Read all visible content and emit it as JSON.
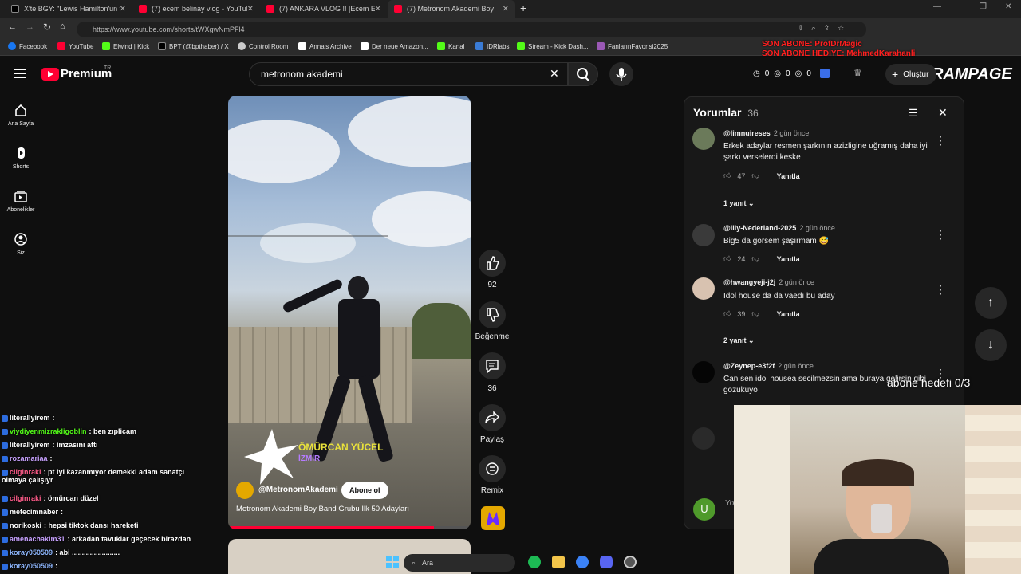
{
  "browser": {
    "tabs": [
      {
        "label": "X'te BGY: \"Lewis Hamilton'un fi",
        "color": "#000000"
      },
      {
        "label": "(7) ecem belinay vlog - YouTube",
        "color": "#ff0033"
      },
      {
        "label": "(7) ANKARA VLOG !! |Ecem Eser",
        "color": "#ff0033"
      },
      {
        "label": "(7) Metronom Akademi Boy",
        "color": "#ff0033"
      }
    ],
    "url": "https://www.youtube.com/shorts/tWXgwNmPFl4",
    "bookmarks": [
      "Facebook",
      "YouTube",
      "Elwind | Kick",
      "BPT (@bpthaber) / X",
      "Control Room",
      "Anna's Archive",
      "Der neue Amazon...",
      "Kanal",
      "IDRlabs",
      "Stream - Kick Dash...",
      "FanlarınFavorisi2025"
    ],
    "bookmark_colors": [
      "#1877f2",
      "#ff0033",
      "#53fc18",
      "#ffffff",
      "#cccccc",
      "#ffffff",
      "#ffffff",
      "#53fc18",
      "#3a7bd5",
      "#53fc18",
      "#9b59b6"
    ]
  },
  "overlay": {
    "top_line1": "SON ABONE: ProfDrMagic",
    "top_line2": "SON ABONE HEDİYE: MehmedKarahanli",
    "brand": "RAMPAGE",
    "abone_hedefi": "abone hedefi 0/3",
    "chat": [
      {
        "user": "literallyirem",
        "msg": ":",
        "color": "#ffffff"
      },
      {
        "user": "viydiyenmizrakligoblin",
        "msg": ": ben zıplicam",
        "color": "#53fc18"
      },
      {
        "user": "literallyirem",
        "msg": ": imzasını attı",
        "color": "#ffffff"
      },
      {
        "user": "rozamariaa",
        "msg": ":",
        "color": "#c8a2ff"
      },
      {
        "user": "cilginraki",
        "msg": ": pt iyi kazanmıyor demekki adam sanatçı olmaya çalışıyr",
        "color": "#ff5c8a"
      },
      {
        "user": "cilginraki",
        "msg": ": ömürcan düzel",
        "color": "#ff5c8a"
      },
      {
        "user": "metecimnaber",
        "msg": ":",
        "color": "#ffffff"
      },
      {
        "user": "norikoski",
        "msg": ": hepsi tiktok dansı hareketi",
        "color": "#ffffff"
      },
      {
        "user": "amenachakim31",
        "msg": ": arkadan tavuklar geçecek birazdan",
        "color": "#c8a2ff"
      },
      {
        "user": "koray050509",
        "msg": ": abi ........................",
        "color": "#8fb8ff"
      },
      {
        "user": "koray050509",
        "msg": ":",
        "color": "#8fb8ff"
      }
    ]
  },
  "youtube": {
    "logo_text": "Premium",
    "logo_sup": "TR",
    "search_value": "metronom akademi",
    "header_counts": [
      "0",
      "0",
      "0"
    ],
    "create_label": "Oluştur",
    "nav": [
      {
        "label": "Ana Sayfa",
        "icon": "home-icon"
      },
      {
        "label": "Shorts",
        "icon": "shorts-icon"
      },
      {
        "label": "Abonelikler",
        "icon": "subscriptions-icon"
      },
      {
        "label": "Siz",
        "icon": "you-icon"
      }
    ],
    "short": {
      "channel": "@MetronomAkademi",
      "subscribe_label": "Abone ol",
      "title": "Metronom Akademi Boy Band Grubu İlk 50 Adayları",
      "watermark_name": "ÖMÜRCAN YÜCEL",
      "watermark_city": "İZMİR",
      "progress": 0.85
    },
    "actions": {
      "like_count": "92",
      "dislike_label": "Beğenme",
      "comment_count": "36",
      "share_label": "Paylaş",
      "remix_label": "Remix"
    },
    "comments": {
      "title": "Yorumlar",
      "count": "36",
      "reply_label": "Yanıtla",
      "items": [
        {
          "author": "@limnuireses",
          "time": "2 gün önce",
          "text": "Erkek adaylar resmen şarkının azizligine uğramış daha iyi şarkı verselerdi keske",
          "likes": "47",
          "replies": "1 yanıt",
          "avatar": "#6b7a5a"
        },
        {
          "author": "@lily-Nederland-2025",
          "time": "2 gün önce",
          "text": "Big5 da görsem şaşırmam 😅",
          "likes": "24",
          "replies": "",
          "avatar": "#3a3a3a"
        },
        {
          "author": "@hwangyeji-j2j",
          "time": "2 gün önce",
          "text": "Idol house da da vaedı bu aday",
          "likes": "39",
          "replies": "2 yanıt",
          "avatar": "#d8c2b0"
        },
        {
          "author": "@Zeynep-e3f2f",
          "time": "2 gün önce",
          "text": "Can sen idol housea secilmezsin ama buraya gelirsin gibi gözüküyo",
          "likes": "",
          "replies": "",
          "avatar": "#050505"
        }
      ],
      "input_placeholder": "Yo",
      "input_avatar_letter": "U"
    }
  },
  "taskbar": {
    "search_label": "Ara"
  }
}
